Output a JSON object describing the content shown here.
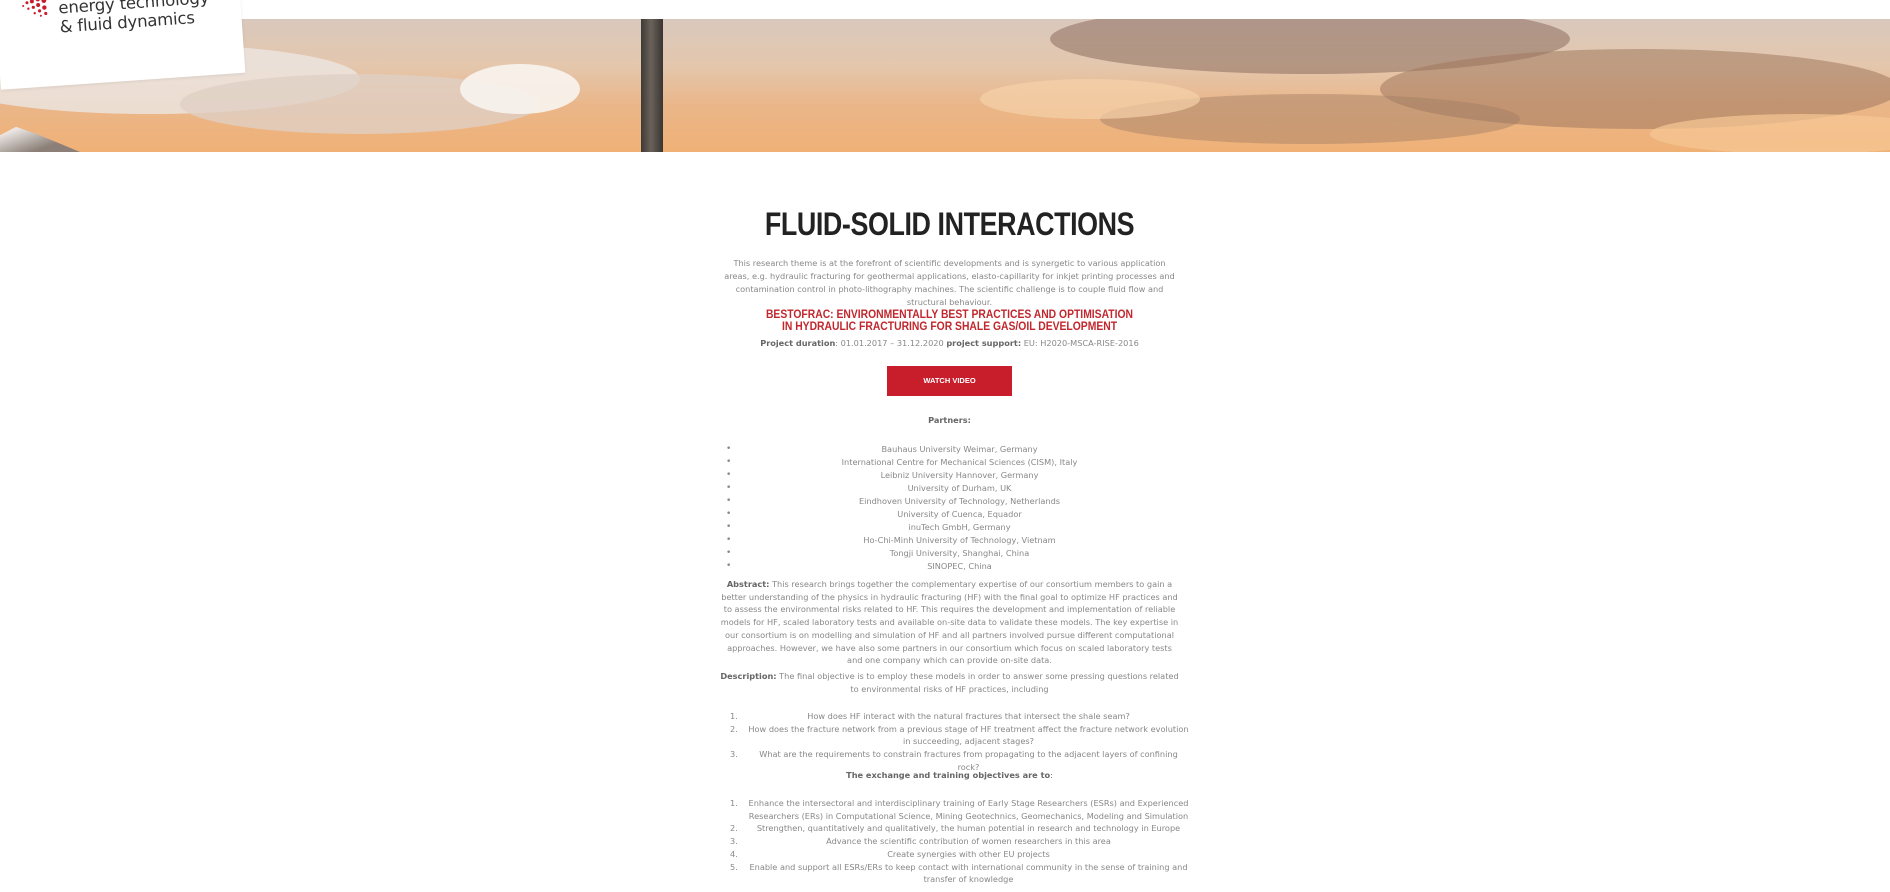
{
  "logo": {
    "lines": [
      "energy technology",
      "& fluid dynamics"
    ],
    "colors": {
      "dots": "#c81d2b",
      "text": "#333333"
    }
  },
  "hero": {
    "image_name": "wind-turbine-sunset-banner"
  },
  "theme": {
    "accent": "#c81d2b",
    "heading": "#222222",
    "text": "#888888"
  },
  "page": {
    "title": "FLUID-SOLID INTERACTIONS",
    "intro": "This research theme is at the forefront of scientific developments and is synergetic to various application areas, e.g. hydraulic fracturing for geothermal applications, elasto-capillarity for inkjet printing processes and contamination control in photo-lithography machines. The scientific challenge is to couple fluid flow and structural behaviour."
  },
  "project": {
    "title": "BESTOFRAC: ENVIRONMENTALLY BEST PRACTICES AND OPTIMISATION IN HYDRAULIC FRACTURING FOR SHALE GAS/OIL DEVELOPMENT",
    "duration_label": "Project duration",
    "duration_value": ": 01.01.2017 – 31.12.2020",
    "support_label": "project support:",
    "support_value": " EU: H2020-MSCA-RISE-2016",
    "video_button": "WATCH VIDEO",
    "partners_label": "Partners:",
    "partners": [
      "Bauhaus University Weimar, Germany",
      "International Centre for Mechanical Sciences (CISM), Italy",
      "Leibniz University Hannover, Germany",
      "University of Durham, UK",
      "Eindhoven University of Technology, Netherlands",
      "University of Cuenca, Equador",
      "inuTech GmbH, Germany",
      "Ho-Chi-Minh University of Technology, Vietnam",
      "Tongji University, Shanghai, China",
      "SINOPEC, China"
    ],
    "abstract_label": "Abstract:",
    "abstract_text": " This research brings together the complementary expertise of our consortium members to gain a better understanding of the physics in hydraulic fracturing (HF) with the final goal to optimize HF practices and to assess the environmental risks related to HF. This requires the development and implementation of reliable models for HF, scaled laboratory tests and available on-site data to validate these models. The key expertise in our consortium is on modelling and simulation of HF and all partners involved pursue different computational approaches. However, we have also some partners in our consortium which focus on scaled laboratory tests and one company which can provide on-site data.",
    "description_label": "Description:",
    "description_text": " The final objective is to employ these models in order to answer some pressing questions related to environmental risks of HF practices, including",
    "questions": [
      {
        "num": "1.",
        "text": "How does HF interact with the natural fractures that intersect the shale seam?"
      },
      {
        "num": "2.",
        "text": "How does the fracture network from a previous stage of HF treatment affect the fracture network evolution in succeeding, adjacent stages?"
      },
      {
        "num": "3.",
        "text": "What are the requirements to constrain fractures from propagating to the adjacent layers of confining rock?"
      }
    ],
    "objectives_label": "The exchange and training objectives are to",
    "objectives_suffix": ":",
    "objectives": [
      {
        "num": "1.",
        "text": "Enhance the intersectoral and interdisciplinary training of Early Stage Researchers (ESRs) and Experienced Researchers (ERs) in Computational Science, Mining Geotechnics, Geomechanics, Modeling and Simulation"
      },
      {
        "num": "2.",
        "text": "Strengthen, quantitatively and qualitatively, the human potential in research and technology in Europe"
      },
      {
        "num": "3.",
        "text": "Advance the scientific contribution of women researchers in this area"
      },
      {
        "num": "4.",
        "text": "Create synergies with other EU projects"
      },
      {
        "num": "5.",
        "text": "Enable and support all ESRs/ERs to keep contact with international community in the sense of training and transfer of knowledge"
      }
    ]
  }
}
